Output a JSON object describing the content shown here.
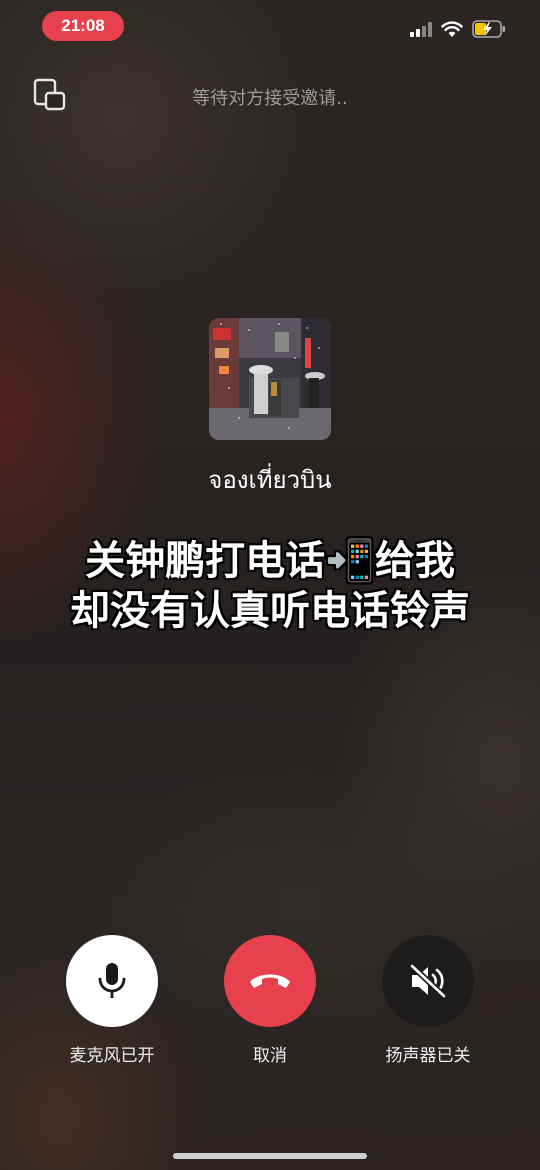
{
  "status_bar": {
    "time": "21:08",
    "accent_color": "#e8414e",
    "icons": [
      "signal-icon",
      "wifi-icon",
      "battery-charging-icon"
    ]
  },
  "call": {
    "status_text": "等待对方接受邀请..",
    "caller_name": "จองเที่ยวบิน",
    "minimize_icon": "minimize-window-icon"
  },
  "caption": {
    "line1": "关钟鹏打电话📲给我",
    "line2": "却没有认真听电话铃声"
  },
  "controls": {
    "mic_label": "麦克风已开",
    "hangup_label": "取消",
    "speaker_label": "扬声器已关",
    "mic_icon": "microphone-icon",
    "hangup_icon": "hang-up-icon",
    "speaker_icon": "speaker-muted-icon",
    "hangup_color": "#e8414e"
  }
}
